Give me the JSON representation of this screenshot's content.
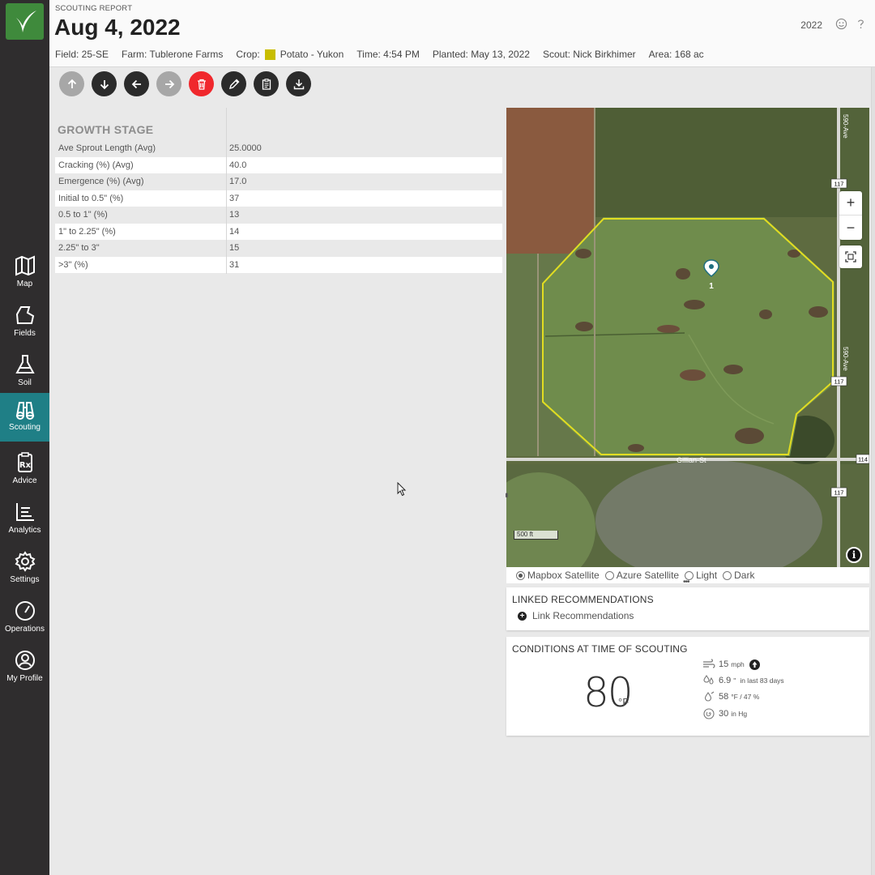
{
  "sidebar": {
    "items": [
      {
        "label": "Map",
        "icon": "map-icon",
        "active": false
      },
      {
        "label": "Fields",
        "icon": "field-icon",
        "active": false
      },
      {
        "label": "Soil",
        "icon": "flask-icon",
        "active": false
      },
      {
        "label": "Scouting",
        "icon": "binoculars-icon",
        "active": true
      },
      {
        "label": "Advice",
        "icon": "prescription-icon",
        "active": false
      },
      {
        "label": "Analytics",
        "icon": "chart-icon",
        "active": false
      },
      {
        "label": "Settings",
        "icon": "gear-icon",
        "active": false
      },
      {
        "label": "Operations",
        "icon": "gauge-icon",
        "active": false
      },
      {
        "label": "My Profile",
        "icon": "user-icon",
        "active": false
      }
    ]
  },
  "header": {
    "report_label": "SCOUTING REPORT",
    "date": "Aug 4, 2022",
    "year": "2022",
    "meta": {
      "field": "Field: 25-SE",
      "farm": "Farm: Tublerone Farms",
      "crop_label": "Crop:",
      "crop_value": "Potato - Yukon",
      "crop_color": "#c8bd00",
      "time": "Time: 4:54 PM",
      "planted": "Planted: May 13, 2022",
      "scout": "Scout: Nick Birkhimer",
      "area": "Area: 168 ac"
    }
  },
  "toolbar": {
    "buttons": [
      {
        "name": "move-up-button",
        "icon": "arrow-up-icon",
        "disabled": true
      },
      {
        "name": "move-down-button",
        "icon": "arrow-down-icon",
        "disabled": false
      },
      {
        "name": "previous-button",
        "icon": "arrow-left-icon",
        "disabled": false
      },
      {
        "name": "next-button",
        "icon": "arrow-right-icon",
        "disabled": true
      },
      {
        "name": "delete-button",
        "icon": "trash-icon",
        "disabled": false
      },
      {
        "name": "edit-button",
        "icon": "pencil-icon",
        "disabled": false
      },
      {
        "name": "clipboard-button",
        "icon": "clipboard-icon",
        "disabled": false
      },
      {
        "name": "download-button",
        "icon": "download-icon",
        "disabled": false
      }
    ]
  },
  "growth_stage": {
    "title": "GROWTH STAGE",
    "rows": [
      {
        "label": "Ave Sprout Length (Avg)",
        "value": "25.0000"
      },
      {
        "label": "Cracking (%) (Avg)",
        "value": "40.0"
      },
      {
        "label": "Emergence (%) (Avg)",
        "value": "17.0"
      },
      {
        "label": "Initial to 0.5\" (%)",
        "value": "37"
      },
      {
        "label": "0.5 to 1\" (%)",
        "value": "13"
      },
      {
        "label": "1\" to 2.25\" (%)",
        "value": "14"
      },
      {
        "label": "2.25\" to 3\"",
        "value": "15"
      },
      {
        "label": ">3\" (%)",
        "value": "31"
      }
    ]
  },
  "map": {
    "marker_label": "1",
    "road_gillian": "Gillian-St",
    "road_590": "590-Ave",
    "road_590_top": "590-Ave",
    "shield_117a": "117",
    "shield_117b": "117",
    "shield_117c": "117",
    "shield_114": "114",
    "scale": "500 ft",
    "zoom_in": "+",
    "zoom_out": "−",
    "info": "i"
  },
  "basemaps": {
    "options": [
      {
        "label": "Mapbox Satellite",
        "selected": true
      },
      {
        "label": "Azure Satellite",
        "selected": false
      },
      {
        "label": "Light",
        "selected": false
      },
      {
        "label": "Dark",
        "selected": false
      }
    ]
  },
  "linked": {
    "title": "LINKED RECOMMENDATIONS",
    "action": "Link Recommendations"
  },
  "conditions": {
    "title": "CONDITIONS AT TIME OF SCOUTING",
    "temperature": "80",
    "temperature_unit": "°F",
    "wind_value": "15",
    "wind_unit": "mph",
    "rain_value": "6.9",
    "rain_unit": "\"",
    "rain_note": "in last 83 days",
    "dew_value": "58",
    "dew_unit": "°F / 47 %",
    "pressure_value": "30",
    "pressure_unit": "in Hg"
  }
}
